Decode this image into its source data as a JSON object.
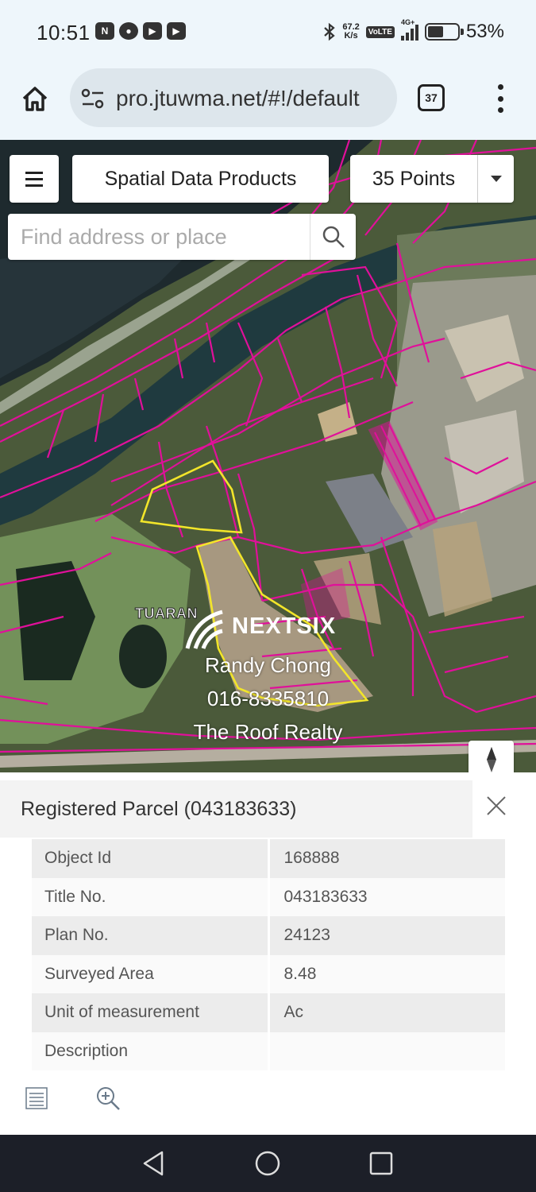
{
  "status_bar": {
    "time": "10:51",
    "speed_top": "67.2",
    "speed_bottom": "K/s",
    "volte": "VoLTE",
    "network": "4G+",
    "battery": "53%",
    "battery_level": 0.53
  },
  "browser": {
    "url": "pro.jtuwma.net/#!/default",
    "tab_count": "37"
  },
  "map": {
    "menu_icon": "hamburger-icon",
    "layer_button": "Spatial Data Products",
    "points_button": "35 Points",
    "search_placeholder": "Find address or place",
    "place_label": "TUARAN",
    "watermark": {
      "brand": "NEXTSIX",
      "name": "Randy Chong",
      "phone": "016-8335810",
      "company": "The Roof Realty"
    },
    "colors": {
      "parcel_outline": "#e0109a",
      "selected_parcel": "#f2e52a"
    }
  },
  "popup": {
    "title": "Registered Parcel (043183633)",
    "attributes": [
      {
        "key": "Object Id",
        "value": "168888"
      },
      {
        "key": "Title No.",
        "value": "043183633"
      },
      {
        "key": "Plan No.",
        "value": "24123"
      },
      {
        "key": "Surveyed Area",
        "value": "8.48"
      },
      {
        "key": "Unit of measurement",
        "value": "Ac"
      },
      {
        "key": "Description",
        "value": ""
      }
    ]
  }
}
